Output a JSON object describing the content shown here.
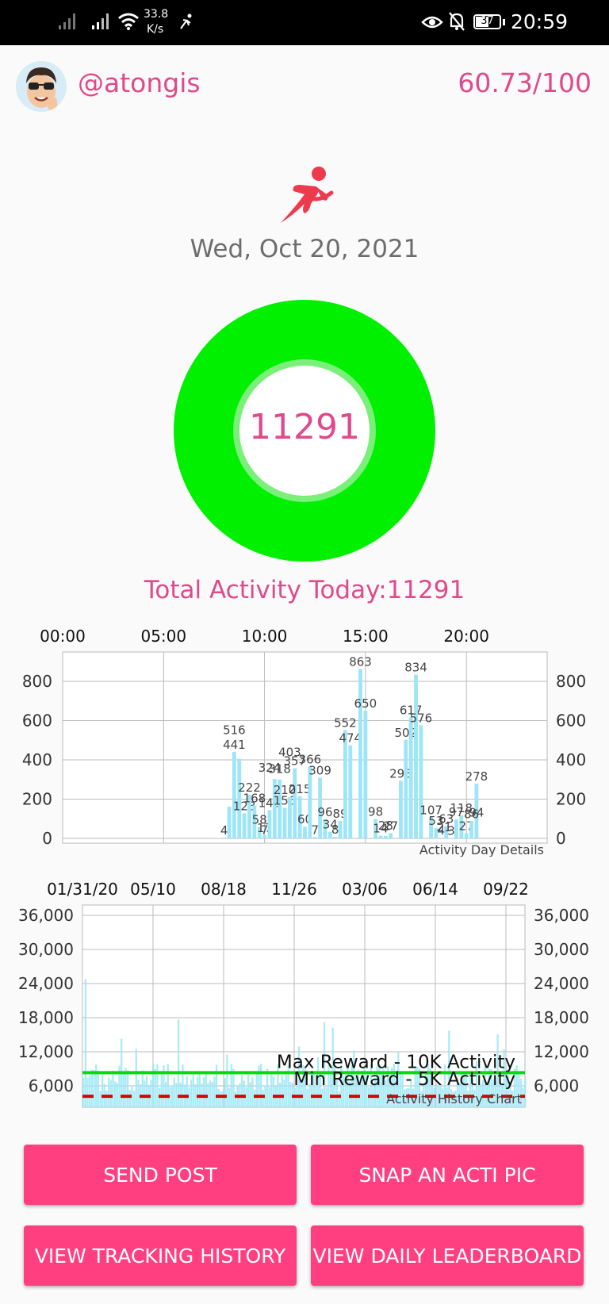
{
  "status_bar": {
    "network_speed_value": "33.8",
    "network_speed_unit": "K/s",
    "battery": "37",
    "time": "20:59"
  },
  "header": {
    "username": "@atongis",
    "score": "60.73/100"
  },
  "main": {
    "date": "Wed, Oct 20, 2021",
    "ring_value": "11291",
    "ring_progress": 1.0,
    "total_activity": "Total Activity Today:11291"
  },
  "colors": {
    "accent": "#e0498a",
    "button": "#ff3f7f",
    "ring": "#00f000",
    "bars": "#9ee6f7",
    "max_line": "#00dd00",
    "min_line": "#dd0000"
  },
  "chart_data": [
    {
      "type": "bar",
      "caption": "Activity Day Details",
      "x_tick_labels": [
        "00:00",
        "05:00",
        "10:00",
        "15:00",
        "20:00"
      ],
      "xlim": [
        0,
        24
      ],
      "y_ticks": [
        0,
        200,
        400,
        600,
        800
      ],
      "ylim": [
        0,
        900
      ],
      "grid": true,
      "bars": [
        {
          "x": 8.0,
          "y": 4,
          "label": "4"
        },
        {
          "x": 8.25,
          "y": 161,
          "label": ""
        },
        {
          "x": 8.5,
          "y": 441,
          "label": "441"
        },
        {
          "x": 8.75,
          "y": 405,
          "label": ""
        },
        {
          "x": 9.0,
          "y": 128,
          "label": "128"
        },
        {
          "x": 9.25,
          "y": 222,
          "label": "222"
        },
        {
          "x": 9.5,
          "y": 168,
          "label": "168"
        },
        {
          "x": 9.75,
          "y": 58,
          "label": "58"
        },
        {
          "x": 10.0,
          "y": 17,
          "label": "17"
        },
        {
          "x": 10.25,
          "y": 143,
          "label": "143"
        },
        {
          "x": 10.5,
          "y": 303,
          "label": ""
        },
        {
          "x": 10.75,
          "y": 300,
          "label": ""
        },
        {
          "x": 11.0,
          "y": 156,
          "label": "156"
        },
        {
          "x": 11.25,
          "y": 210,
          "label": ""
        },
        {
          "x": 11.5,
          "y": 357,
          "label": "357"
        },
        {
          "x": 11.75,
          "y": 215,
          "label": "215"
        },
        {
          "x": 12.0,
          "y": 60,
          "label": "60"
        },
        {
          "x": 12.25,
          "y": 366,
          "label": "366"
        },
        {
          "x": 12.5,
          "y": 7,
          "label": "7"
        },
        {
          "x": 12.75,
          "y": 309,
          "label": "309"
        },
        {
          "x": 13.0,
          "y": 96,
          "label": "96"
        },
        {
          "x": 13.25,
          "y": 34,
          "label": "34"
        },
        {
          "x": 13.5,
          "y": 8,
          "label": "8"
        },
        {
          "x": 13.75,
          "y": 89,
          "label": "89"
        },
        {
          "x": 14.0,
          "y": 552,
          "label": "552"
        },
        {
          "x": 14.25,
          "y": 474,
          "label": "474"
        },
        {
          "x": 14.75,
          "y": 863,
          "label": "863"
        },
        {
          "x": 15.0,
          "y": 650,
          "label": "650"
        },
        {
          "x": 15.5,
          "y": 98,
          "label": "98"
        },
        {
          "x": 15.75,
          "y": 14,
          "label": ""
        },
        {
          "x": 16.0,
          "y": 12,
          "label": ""
        },
        {
          "x": 16.25,
          "y": 27,
          "label": "27"
        },
        {
          "x": 16.75,
          "y": 293,
          "label": "293"
        },
        {
          "x": 17.0,
          "y": 502,
          "label": "502"
        },
        {
          "x": 17.25,
          "y": 617,
          "label": "617"
        },
        {
          "x": 17.5,
          "y": 834,
          "label": "834"
        },
        {
          "x": 17.75,
          "y": 576,
          "label": "576"
        },
        {
          "x": 18.25,
          "y": 107,
          "label": "107"
        },
        {
          "x": 18.5,
          "y": 53,
          "label": "53"
        },
        {
          "x": 18.75,
          "y": 4,
          "label": "4"
        },
        {
          "x": 19.0,
          "y": 63,
          "label": "63"
        },
        {
          "x": 19.25,
          "y": 3,
          "label": "3"
        },
        {
          "x": 19.5,
          "y": 97,
          "label": ""
        },
        {
          "x": 19.75,
          "y": 118,
          "label": "118"
        },
        {
          "x": 20.0,
          "y": 27,
          "label": "27"
        },
        {
          "x": 20.25,
          "y": 86,
          "label": ""
        },
        {
          "x": 20.5,
          "y": 278,
          "label": "278"
        }
      ],
      "extra_labels": [
        {
          "x": 8.5,
          "y": 516,
          "label": "516"
        },
        {
          "x": 10.25,
          "y": 324,
          "label": "324"
        },
        {
          "x": 10.75,
          "y": 318,
          "label": "318"
        },
        {
          "x": 11.25,
          "y": 403,
          "label": "403"
        },
        {
          "x": 11.0,
          "y": 210,
          "label": "210"
        },
        {
          "x": 10.0,
          "y": 7,
          "label": "7"
        },
        {
          "x": 15.75,
          "y": 14,
          "label": "14"
        },
        {
          "x": 16.0,
          "y": 28,
          "label": "28"
        },
        {
          "x": 18.9,
          "y": 21,
          "label": "21"
        },
        {
          "x": 19.5,
          "y": 97,
          "label": "97"
        },
        {
          "x": 20.25,
          "y": 86,
          "label": "86"
        },
        {
          "x": 20.5,
          "y": 94,
          "label": "94"
        }
      ]
    },
    {
      "type": "bar",
      "caption": "Activity History Chart",
      "x_tick_labels": [
        "01/31/20",
        "05/10",
        "08/18",
        "11/26",
        "03/06",
        "06/14",
        "09/22"
      ],
      "y_ticks": [
        6000,
        12000,
        18000,
        24000,
        30000,
        36000
      ],
      "ylim": [
        4000,
        38000
      ],
      "grid": true,
      "lines": [
        {
          "name": "Max Reward - 10K Activity",
          "y": 10000,
          "style": "solid",
          "color": "#00dd00"
        },
        {
          "name": "Min Reward - 5K Activity",
          "y": 5000,
          "style": "dashed",
          "color": "#dd0000"
        }
      ],
      "days": 628,
      "value_profile": {
        "min": 5000,
        "typical_max": 15000,
        "peak": 32500
      }
    }
  ],
  "buttons": {
    "send_post": "SEND POST",
    "snap_pic": "SNAP AN ACTI PIC",
    "tracking_history": "VIEW TRACKING HISTORY",
    "daily_leaderboard": "VIEW DAILY LEADERBOARD"
  }
}
